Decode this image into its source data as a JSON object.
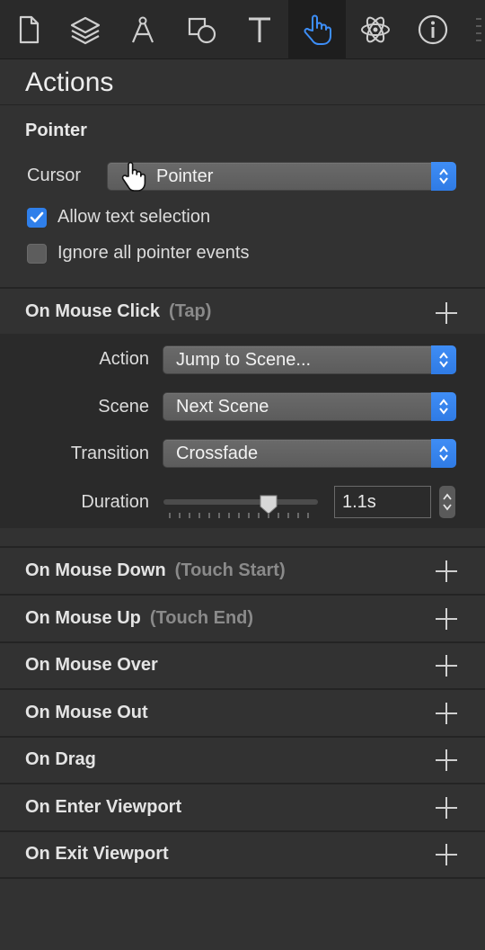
{
  "toolbar": {
    "icons": [
      "document-icon",
      "layers-icon",
      "pen-tool-icon",
      "shapes-icon",
      "text-icon",
      "hand-pointer-icon",
      "atom-icon",
      "info-icon"
    ],
    "active": "hand-pointer-icon",
    "accent": "#3d8ef7"
  },
  "panel": {
    "title": "Actions"
  },
  "pointer": {
    "heading": "Pointer",
    "cursor_label": "Cursor",
    "cursor_value": "Pointer",
    "allow_text_selection": {
      "label": "Allow text selection",
      "checked": true
    },
    "ignore_pointer_events": {
      "label": "Ignore all pointer events",
      "checked": false
    }
  },
  "on_click": {
    "label": "On Mouse Click",
    "sub": "(Tap)",
    "action_label": "Action",
    "action_value": "Jump to Scene...",
    "scene_label": "Scene",
    "scene_value": "Next Scene",
    "transition_label": "Transition",
    "transition_value": "Crossfade",
    "duration_label": "Duration",
    "duration_value": "1.1s",
    "duration_slider_fraction": 0.68
  },
  "events": [
    {
      "label": "On Mouse Down",
      "sub": "(Touch Start)"
    },
    {
      "label": "On Mouse Up",
      "sub": "(Touch End)"
    },
    {
      "label": "On Mouse Over",
      "sub": ""
    },
    {
      "label": "On Mouse Out",
      "sub": ""
    },
    {
      "label": "On Drag",
      "sub": ""
    },
    {
      "label": "On Enter Viewport",
      "sub": ""
    },
    {
      "label": "On Exit Viewport",
      "sub": ""
    }
  ]
}
